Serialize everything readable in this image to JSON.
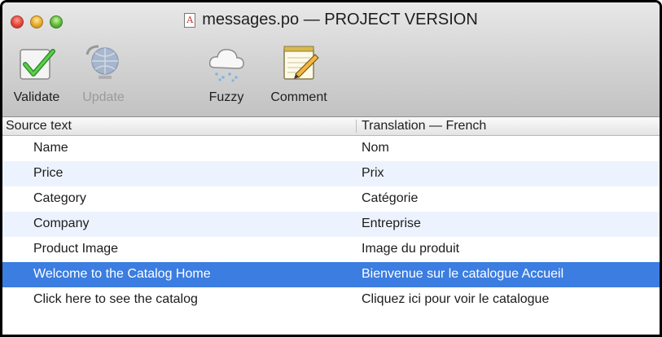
{
  "window": {
    "title": "messages.po — PROJECT VERSION"
  },
  "toolbar": {
    "validate_label": "Validate",
    "update_label": "Update",
    "fuzzy_label": "Fuzzy",
    "comment_label": "Comment"
  },
  "table": {
    "columns": [
      "Source text",
      "Translation — French"
    ],
    "rows": [
      {
        "source": "Name",
        "translation": "Nom"
      },
      {
        "source": "Price",
        "translation": "Prix"
      },
      {
        "source": "Category",
        "translation": "Catégorie"
      },
      {
        "source": "Company",
        "translation": "Entreprise"
      },
      {
        "source": "Product Image",
        "translation": "Image du produit"
      },
      {
        "source": "Welcome to the Catalog Home",
        "translation": "Bienvenue sur le catalogue Accueil"
      },
      {
        "source": "Click here to see the catalog",
        "translation": "Cliquez ici pour voir le catalogue"
      }
    ]
  },
  "colors": {
    "selection": "#3b7de0",
    "row_stripe": "#edf3fe"
  }
}
